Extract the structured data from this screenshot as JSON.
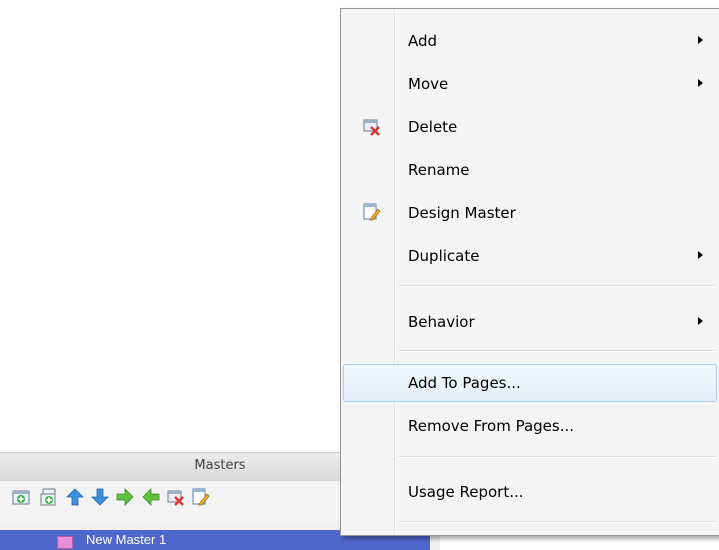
{
  "masters_panel": {
    "title": "Masters",
    "toolbar": [
      {
        "name": "add-master-icon"
      },
      {
        "name": "add-folder-icon"
      },
      {
        "name": "move-up-icon"
      },
      {
        "name": "move-down-icon"
      },
      {
        "name": "indent-right-icon"
      },
      {
        "name": "outdent-left-icon"
      },
      {
        "name": "delete-icon"
      },
      {
        "name": "design-master-icon"
      }
    ],
    "items": [
      {
        "label": "New Master 1",
        "selected": true
      }
    ]
  },
  "context_menu": {
    "items": [
      {
        "label": "Add",
        "submenu": true
      },
      {
        "label": "Move",
        "submenu": true
      },
      {
        "label": "Delete",
        "icon": "delete-icon"
      },
      {
        "label": "Rename"
      },
      {
        "label": "Design Master",
        "icon": "design-master-icon"
      },
      {
        "label": "Duplicate",
        "submenu": true
      },
      {
        "label": "Behavior",
        "submenu": true
      },
      {
        "label": "Add To Pages...",
        "highlighted": true
      },
      {
        "label": "Remove From Pages..."
      },
      {
        "label": "Usage Report..."
      }
    ]
  },
  "colors": {
    "selection": "#4f67cc",
    "menu_hover_border": "#a8cdf0",
    "menu_background": "#f4f4f4"
  }
}
